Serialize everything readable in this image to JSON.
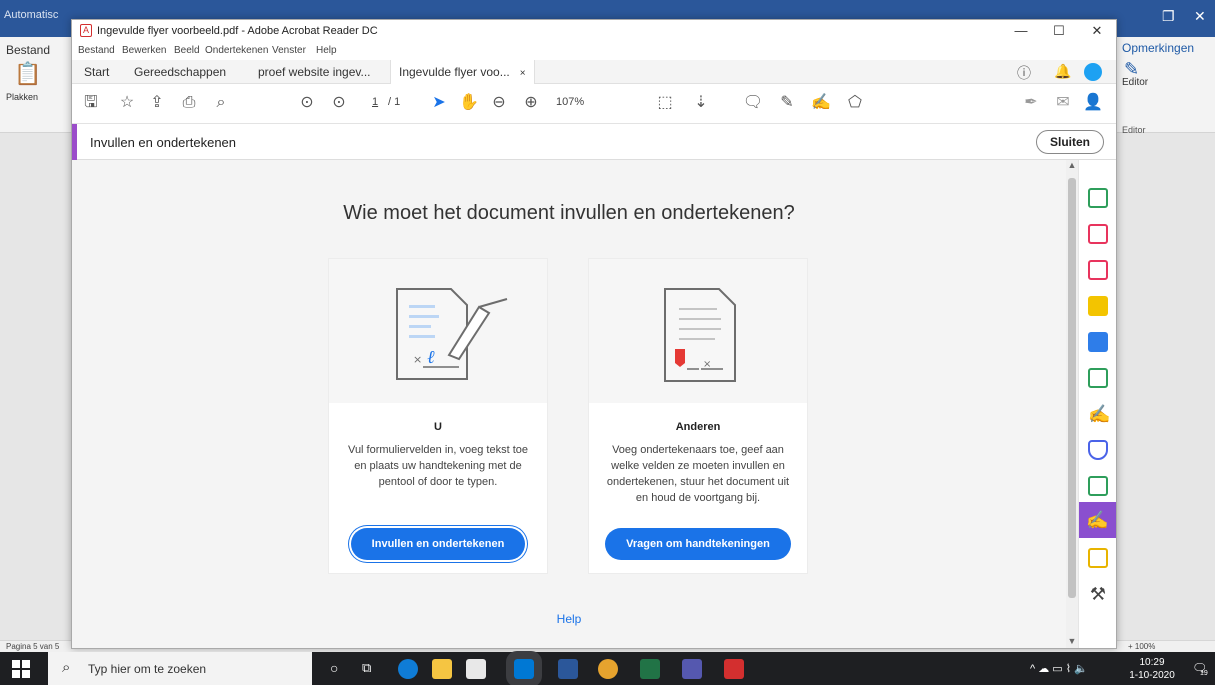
{
  "word": {
    "title_left": "Automatisc",
    "bestand": "Bestand",
    "plakken": "Plakken",
    "opmerkingen": "Opmerkingen",
    "editor": "Editor",
    "editor_group": "Editor",
    "status_page": "Pagina 5 van 5",
    "zoom": "+ 100%"
  },
  "acrobat": {
    "window_title": "Ingevulde flyer voorbeeld.pdf - Adobe Acrobat Reader DC",
    "menu": [
      "Bestand",
      "Bewerken",
      "Beeld",
      "Ondertekenen",
      "Venster",
      "Help"
    ],
    "tabs": {
      "start": "Start",
      "tools": "Gereedschappen",
      "doc1": "proef website ingev...",
      "doc2": "Ingevulde flyer voo...",
      "close": "×"
    },
    "toolbar": {
      "page_current": "1",
      "page_total": "/ 1",
      "zoom": "107%"
    },
    "fill_bar": {
      "label": "Invullen en ondertekenen",
      "close_button": "Sluiten"
    },
    "content": {
      "heading": "Wie moet het document invullen en ondertekenen?",
      "card_you": {
        "title": "U",
        "description": "Vul formuliervelden in, voeg tekst toe en plaats uw handtekening met de pentool of door te typen.",
        "button": "Invullen en ondertekenen"
      },
      "card_others": {
        "title": "Anderen",
        "description": "Voeg ondertekenaars toe, geef aan welke velden ze moeten invullen en ondertekenen, stuur het document uit en houd de voortgang bij.",
        "button": "Vragen om handtekeningen"
      },
      "help": "Help"
    },
    "side_tools": [
      {
        "icon": "export-pdf-icon",
        "color": "#2e9e5b"
      },
      {
        "icon": "organize-pages-icon",
        "color": "#e8345d"
      },
      {
        "icon": "create-pdf-icon",
        "color": "#e8345d"
      },
      {
        "icon": "comment-icon",
        "color": "#f3c400"
      },
      {
        "icon": "combine-files-icon",
        "color": "#2e7de9"
      },
      {
        "icon": "compress-icon",
        "color": "#2e9e5b"
      },
      {
        "icon": "sign-icon",
        "color": "#d23082"
      },
      {
        "icon": "protect-icon",
        "color": "#4a63e8"
      },
      {
        "icon": "measure-icon",
        "color": "#2e9e5b"
      },
      {
        "icon": "fill-sign-icon",
        "color": "#8a4fcf"
      },
      {
        "icon": "send-review-icon",
        "color": "#e8b400"
      },
      {
        "icon": "more-tools-icon",
        "color": "#444444"
      }
    ]
  },
  "taskbar": {
    "search_placeholder": "Typ hier om te zoeken",
    "time": "10:29",
    "date": "1-10-2020",
    "notification_count": "19"
  }
}
